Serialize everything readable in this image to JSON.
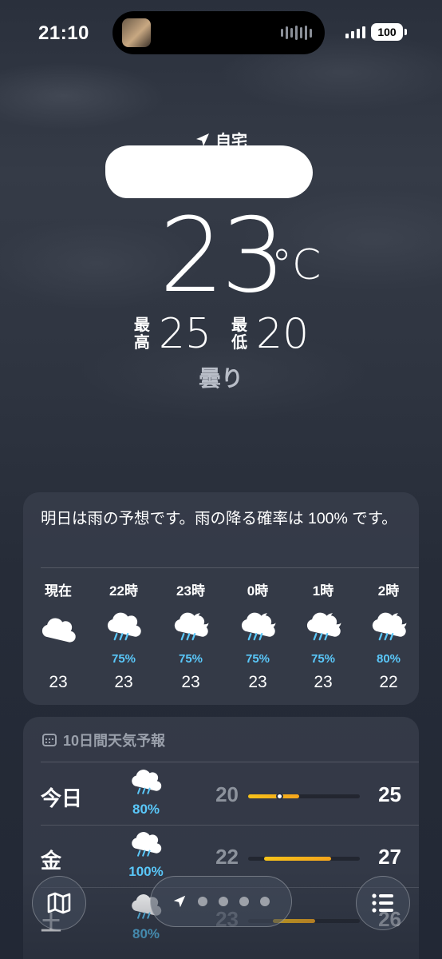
{
  "status_bar": {
    "time": "21:10",
    "battery": "100"
  },
  "location": {
    "label": "自宅",
    "icon": "location-arrow-icon"
  },
  "current": {
    "temp": "23",
    "unit": "°C",
    "high_label": "最高",
    "high": "25",
    "low_label": "最低",
    "low": "20",
    "condition": "曇り"
  },
  "hourly": {
    "summary": "明日は雨の予想です。雨の降る確率は 100% です。",
    "items": [
      {
        "label": "現在",
        "icon": "cloud-icon",
        "pct": "",
        "temp": "23"
      },
      {
        "label": "22時",
        "icon": "cloud-rain-icon",
        "pct": "75%",
        "temp": "23"
      },
      {
        "label": "23時",
        "icon": "moon-cloud-rain-icon",
        "pct": "75%",
        "temp": "23"
      },
      {
        "label": "0時",
        "icon": "moon-cloud-rain-icon",
        "pct": "75%",
        "temp": "23"
      },
      {
        "label": "1時",
        "icon": "moon-cloud-rain-icon",
        "pct": "75%",
        "temp": "23"
      },
      {
        "label": "2時",
        "icon": "moon-cloud-rain-icon",
        "pct": "80%",
        "temp": "22"
      }
    ]
  },
  "daily": {
    "title": "10日間天気予報",
    "items": [
      {
        "day": "今日",
        "icon": "cloud-rain-icon",
        "pct": "80%",
        "low": "20",
        "high": "25",
        "range_start": 0.0,
        "range_end": 0.46,
        "current": 0.28
      },
      {
        "day": "金",
        "icon": "cloud-rain-icon",
        "pct": "100%",
        "low": "22",
        "high": "27",
        "range_start": 0.14,
        "range_end": 0.74
      },
      {
        "day": "土",
        "icon": "cloud-rain-icon",
        "pct": "80%",
        "low": "23",
        "high": "26",
        "range_start": 0.22,
        "range_end": 0.6
      }
    ]
  },
  "toolbar": {
    "map_icon": "map-icon",
    "location_icon": "location-arrow-icon",
    "list_icon": "list-icon",
    "pages": 5
  },
  "colors": {
    "precip": "#5ac8fa",
    "range_bar": "#f7c31a"
  }
}
